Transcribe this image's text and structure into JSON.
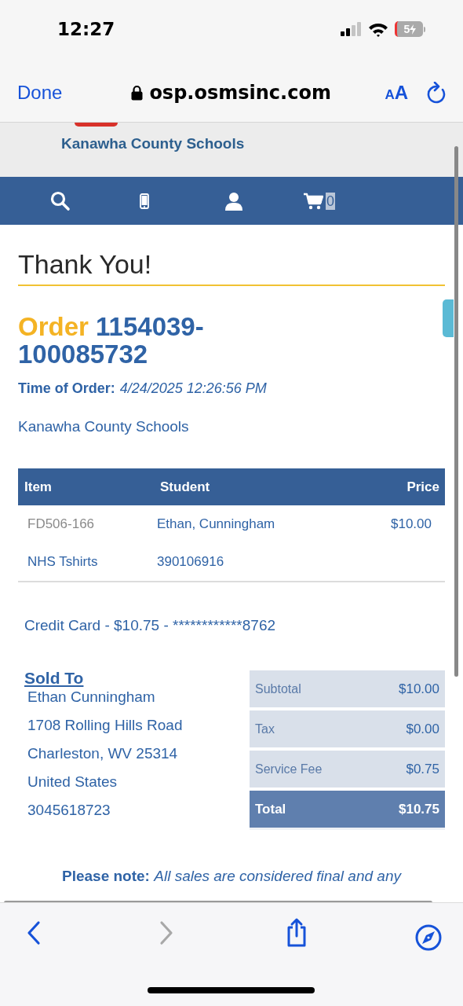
{
  "status_bar": {
    "time": "12:27",
    "battery": "5"
  },
  "browser": {
    "done": "Done",
    "url": "osp.osmsinc.com",
    "text_size": "AA"
  },
  "site": {
    "name": "Kanawha County Schools",
    "cart_count": "0"
  },
  "heading": "Thank You!",
  "order": {
    "label": "Order",
    "number": "1154039-100085732",
    "time_label": "Time of Order:",
    "time": "4/24/2025 12:26:56 PM",
    "district": "Kanawha County Schools"
  },
  "table": {
    "columns": [
      "Item",
      "Student",
      "Price"
    ],
    "rows": [
      {
        "item": "FD506-166",
        "student": "Ethan, Cunningham",
        "price": "$10.00",
        "kind": "code"
      },
      {
        "item": "NHS Tshirts",
        "student": "390106916",
        "kind": "name"
      }
    ]
  },
  "payment": "Credit Card - $10.75 - ************8762",
  "sold_to": {
    "title": "Sold To",
    "lines": [
      "Ethan Cunningham",
      "1708 Rolling Hills Road",
      "Charleston, WV 25314",
      "United States",
      "3045618723"
    ]
  },
  "totals": [
    {
      "label": "Subtotal",
      "value": "$10.00",
      "kind": "line"
    },
    {
      "label": "Tax",
      "value": "$0.00",
      "kind": "line"
    },
    {
      "label": "Service Fee",
      "value": "$0.75",
      "kind": "line"
    },
    {
      "label": "Total",
      "value": "$10.75",
      "kind": "total"
    }
  ],
  "note": "**Please note:** *All sales are considered final and any*"
}
